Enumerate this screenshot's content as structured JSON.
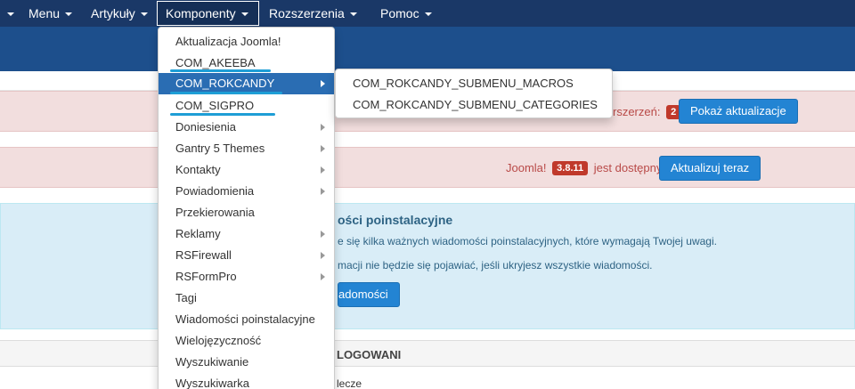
{
  "nav": {
    "items": [
      {
        "label": "",
        "caret": true
      },
      {
        "label": "Menu"
      },
      {
        "label": "Artykuły"
      },
      {
        "label": "Komponenty"
      },
      {
        "label": "Rozszerzenia"
      },
      {
        "label": "Pomoc"
      }
    ],
    "active": "Komponenty"
  },
  "dropdown": {
    "items": [
      {
        "label": "Aktualizacja Joomla!",
        "submenu": false
      },
      {
        "label": "COM_AKEEBA",
        "submenu": false
      },
      {
        "label": "COM_ROKCANDY",
        "submenu": true,
        "active": true
      },
      {
        "label": "COM_SIGPRO",
        "submenu": false
      },
      {
        "label": "Doniesienia",
        "submenu": true
      },
      {
        "label": "Gantry 5 Themes",
        "submenu": true
      },
      {
        "label": "Kontakty",
        "submenu": true
      },
      {
        "label": "Powiadomienia",
        "submenu": true
      },
      {
        "label": "Przekierowania",
        "submenu": false
      },
      {
        "label": "Reklamy",
        "submenu": true
      },
      {
        "label": "RSFirewall",
        "submenu": true
      },
      {
        "label": "RSFormPro",
        "submenu": true
      },
      {
        "label": "Tagi",
        "submenu": false
      },
      {
        "label": "Wiadomości poinstalacyjne",
        "submenu": false
      },
      {
        "label": "Wielojęzyczność",
        "submenu": false
      },
      {
        "label": "Wyszukiwanie",
        "submenu": false
      },
      {
        "label": "Wyszukiwarka",
        "submenu": false
      }
    ]
  },
  "submenu": {
    "items": [
      "COM_ROKCANDY_SUBMENU_MACROS",
      "COM_ROKCANDY_SUBMENU_CATEGORIES"
    ]
  },
  "alert1": {
    "text": "rszerzeń:",
    "badge": "2",
    "button": "Pokaż aktualizacje"
  },
  "alert2": {
    "prefix": "Joomla!",
    "badge": "3.8.11",
    "suffix": "jest dostępny",
    "button": "Aktualizuj teraz"
  },
  "info": {
    "title": "ości poinstalacyjne",
    "line1": "e się kilka ważnych wiadomości poinstalacyjnych, które wymagają Twojej uwagi.",
    "line2": "macji nie będzie się pojawiać, jeśli ukryjesz wszystkie wiadomości.",
    "button": "adomości"
  },
  "panel": {
    "heading": "LOGOWANI",
    "row": "lecze"
  },
  "colors": {
    "navbar": "#1a3867",
    "header": "#1d4f8c",
    "accent": "#2a6db3",
    "button": "#2384d3",
    "danger_bg": "#f2dede",
    "info_bg": "#d9edf7",
    "highlight_underline": "#1e9ed6"
  }
}
